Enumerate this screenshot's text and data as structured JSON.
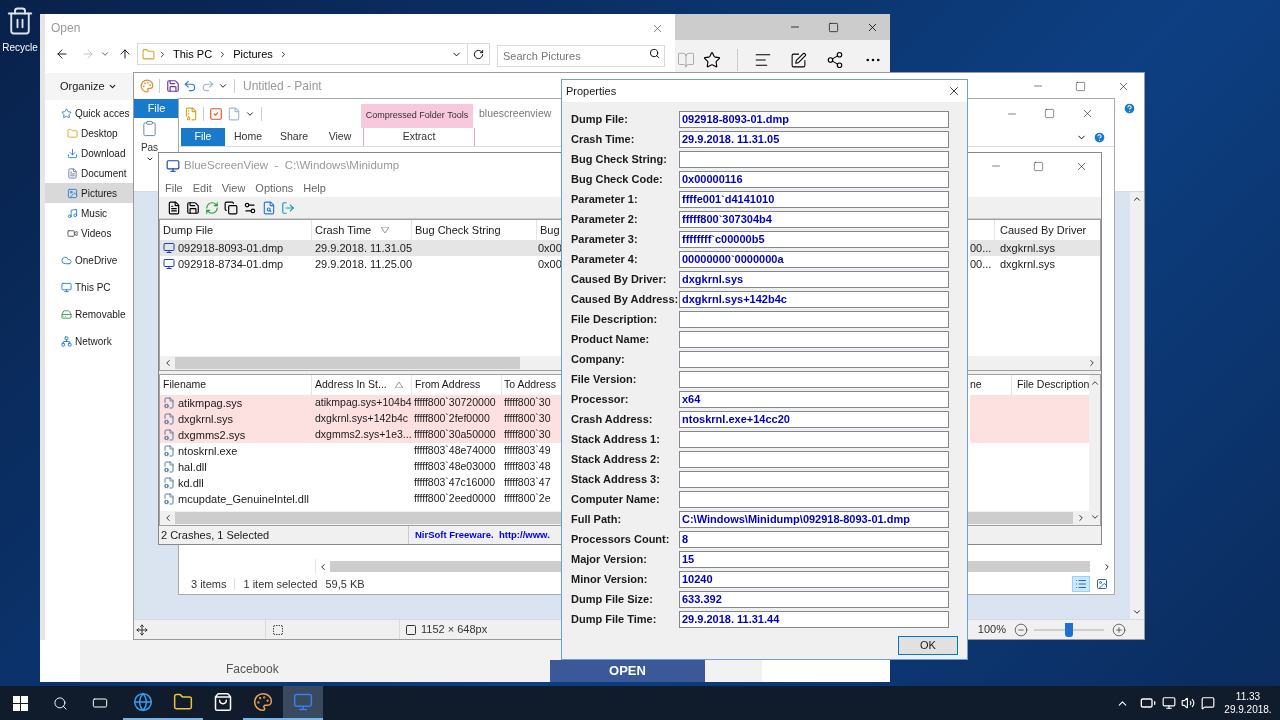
{
  "desktop": {
    "icon_label": "Recycle"
  },
  "browser": {
    "page_link": "Facebook",
    "page_button": "OPEN"
  },
  "open_dialog": {
    "title": "Open",
    "breadcrumb": [
      "This PC",
      "Pictures"
    ],
    "search": {
      "placeholder": "Search Pictures"
    },
    "organize": "Organize",
    "nav": [
      {
        "label": "Quick acces",
        "kind": "star",
        "selected": false,
        "children": [
          {
            "label": "Desktop",
            "kind": "folder",
            "selected": false
          },
          {
            "label": "Download",
            "kind": "download",
            "selected": false
          },
          {
            "label": "Document",
            "kind": "document",
            "selected": false
          },
          {
            "label": "Pictures",
            "kind": "pictures",
            "selected": true
          },
          {
            "label": "Music",
            "kind": "music",
            "selected": false
          },
          {
            "label": "Videos",
            "kind": "video",
            "selected": false
          }
        ]
      },
      {
        "label": "OneDrive",
        "kind": "cloud",
        "selected": false
      },
      {
        "label": "This PC",
        "kind": "computer",
        "selected": false
      },
      {
        "label": "Removable",
        "kind": "drive",
        "selected": false
      },
      {
        "label": "Network",
        "kind": "network",
        "selected": false
      }
    ]
  },
  "paint": {
    "title": "Untitled - Paint",
    "file_tab": "File",
    "paste": "Pas",
    "status": {
      "dimensions": "1152 × 648px",
      "zoom": "100%"
    },
    "zoom_slider": {
      "level": 0.5
    }
  },
  "explorer": {
    "context_group": "Compressed Folder Tools",
    "title": "bluescreenview",
    "tabs": [
      {
        "label": "File",
        "kind": "file",
        "selected": false
      },
      {
        "label": "Home",
        "kind": "tab",
        "selected": false
      },
      {
        "label": "Share",
        "kind": "tab",
        "selected": false
      },
      {
        "label": "View",
        "kind": "tab",
        "selected": false
      },
      {
        "label": "Extract",
        "kind": "context",
        "selected": false
      }
    ],
    "status": [
      "3 items",
      "1 item selected",
      "59,5 KB"
    ],
    "view_buttons": [
      {
        "kind": "details",
        "selected": true
      },
      {
        "kind": "thumbnails",
        "selected": false
      }
    ]
  },
  "bluescreenview": {
    "title": "BlueScreenView  -  C:\\Windows\\Minidump",
    "menu": [
      "File",
      "Edit",
      "View",
      "Options",
      "Help"
    ],
    "crashes": {
      "columns": [
        "Dump File",
        "Crash Time",
        "Bug Check String",
        "Bug"
      ],
      "right_columns": [
        "Caused By Driver"
      ],
      "rows": [
        {
          "dump_file": "092918-8093-01.dmp",
          "crash_time": "29.9.2018. 11.31.05",
          "column_4": "0x00",
          "column_5": "00...",
          "caused_by_driver": "dxgkrnl.sys",
          "selected": true
        },
        {
          "dump_file": "092918-8734-01.dmp",
          "crash_time": "29.9.2018. 11.25.00",
          "column_4": "0x00",
          "column_5": "00...",
          "caused_by_driver": "dxgkrnl.sys",
          "selected": false
        }
      ]
    },
    "modules": {
      "columns": [
        "Filename",
        "Address In St...",
        "From Address",
        "To Address"
      ],
      "right_columns": [
        "ne",
        "File Description"
      ],
      "rows": [
        {
          "filename": "atikmpag.sys",
          "address_in_stack": "atikmpag.sys+104b4",
          "from_address": "fffff800`30720000",
          "to_address": "fffff800`30",
          "highlighted": true
        },
        {
          "filename": "dxgkrnl.sys",
          "address_in_stack": "dxgkrnl.sys+142b4c",
          "from_address": "fffff800`2fef0000",
          "to_address": "fffff800`30",
          "highlighted": true
        },
        {
          "filename": "dxgmms2.sys",
          "address_in_stack": "dxgmms2.sys+1e3...",
          "from_address": "fffff800`30a50000",
          "to_address": "fffff800`30",
          "highlighted": true
        },
        {
          "filename": "ntoskrnl.exe",
          "from_address": "fffff803`48e74000",
          "to_address": "fffff803`49",
          "highlighted": false
        },
        {
          "filename": "hal.dll",
          "from_address": "fffff803`48e03000",
          "to_address": "fffff803`48",
          "highlighted": false
        },
        {
          "filename": "kd.dll",
          "from_address": "fffff803`47c16000",
          "to_address": "fffff803`47",
          "highlighted": false
        },
        {
          "filename": "mcupdate_GenuineIntel.dll",
          "from_address": "fffff800`2eed0000",
          "to_address": "fffff800`2e",
          "highlighted": false
        }
      ]
    },
    "status": {
      "summary": "2 Crashes, 1 Selected",
      "credit": "NirSoft Freeware.  http://www."
    }
  },
  "properties": {
    "title": "Properties",
    "fields": [
      {
        "label": "Dump File:",
        "value": "092918-8093-01.dmp"
      },
      {
        "label": "Crash Time:",
        "value": "29.9.2018. 11.31.05"
      },
      {
        "label": "Bug Check String:"
      },
      {
        "label": "Bug Check Code:",
        "value": "0x00000116"
      },
      {
        "label": "Parameter 1:",
        "value": "ffffe001`d4141010"
      },
      {
        "label": "Parameter 2:",
        "value": "fffff800`307304b4"
      },
      {
        "label": "Parameter 3:",
        "value": "ffffffff`c00000b5"
      },
      {
        "label": "Parameter 4:",
        "value": "00000000`0000000a"
      },
      {
        "label": "Caused By Driver:",
        "value": "dxgkrnl.sys"
      },
      {
        "label": "Caused By Address:",
        "value": "dxgkrnl.sys+142b4c"
      },
      {
        "label": "File Description:"
      },
      {
        "label": "Product Name:"
      },
      {
        "label": "Company:"
      },
      {
        "label": "File Version:"
      },
      {
        "label": "Processor:",
        "value": "x64"
      },
      {
        "label": "Crash Address:",
        "value": "ntoskrnl.exe+14cc20"
      },
      {
        "label": "Stack Address 1:"
      },
      {
        "label": "Stack Address 2:"
      },
      {
        "label": "Stack Address 3:"
      },
      {
        "label": "Computer Name:"
      },
      {
        "label": "Full Path:",
        "value": "C:\\Windows\\Minidump\\092918-8093-01.dmp"
      },
      {
        "label": "Processors Count:",
        "value": "8"
      },
      {
        "label": "Major Version:",
        "value": "15"
      },
      {
        "label": "Minor Version:",
        "value": "10240"
      },
      {
        "label": "Dump File Size:",
        "value": "633.392"
      },
      {
        "label": "Dump File Time:",
        "value": "29.9.2018. 11.31.44"
      }
    ],
    "ok": "OK"
  },
  "taskbar": {
    "apps": [
      {
        "kind": "browser",
        "running": true,
        "selected": false
      },
      {
        "kind": "folder",
        "running": true,
        "selected": false
      },
      {
        "kind": "store",
        "running": false,
        "selected": false
      },
      {
        "kind": "paint",
        "running": true,
        "selected": false
      },
      {
        "kind": "monitor",
        "running": true,
        "selected": true
      }
    ],
    "clock": {
      "time": "11.33",
      "date": "29.9.2018."
    }
  }
}
